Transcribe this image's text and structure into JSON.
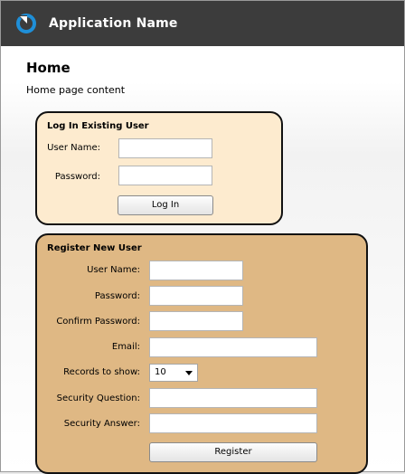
{
  "app": {
    "title": "Application Name"
  },
  "page": {
    "title": "Home",
    "content_text": "Home page content"
  },
  "login": {
    "title": "Log In Existing User",
    "username_label": "User Name:",
    "username_value": "",
    "password_label": "Password:",
    "password_value": "",
    "button_label": "Log In"
  },
  "register": {
    "title": "Register New User",
    "username_label": "User Name:",
    "password_label": "Password:",
    "confirm_label": "Confirm Password:",
    "email_label": "Email:",
    "records_label": "Records to show:",
    "records_value": "10",
    "question_label": "Security Question:",
    "answer_label": "Security Answer:",
    "button_label": "Register"
  },
  "colors": {
    "header_bg": "#3c3c3c",
    "logo_blue": "#1f8fd8",
    "login_panel_bg": "#fdebcf",
    "register_panel_bg": "#dfb884"
  }
}
